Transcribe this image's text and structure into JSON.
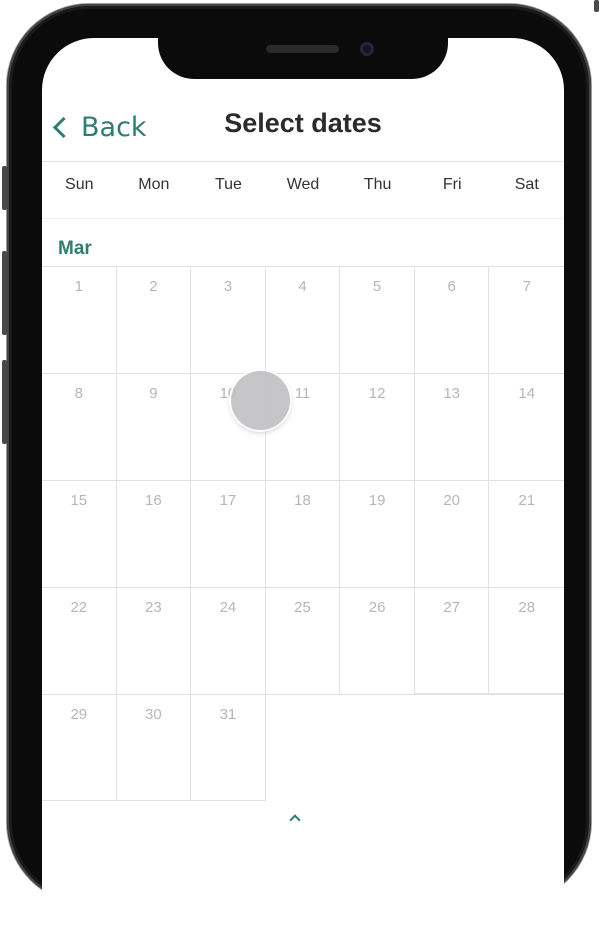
{
  "header": {
    "back_label": "Back",
    "title": "Select dates"
  },
  "weekdays": [
    "Sun",
    "Mon",
    "Tue",
    "Wed",
    "Thu",
    "Fri",
    "Sat"
  ],
  "calendar": {
    "month": "Mar",
    "weeks": [
      [
        "1",
        "2",
        "3",
        "4",
        "5",
        "6",
        "7"
      ],
      [
        "8",
        "9",
        "10",
        "11",
        "12",
        "13",
        "14"
      ],
      [
        "15",
        "16",
        "17",
        "18",
        "19",
        "20",
        "21"
      ],
      [
        "22",
        "23",
        "24",
        "25",
        "26",
        "27",
        "28"
      ],
      [
        "29",
        "30",
        "31"
      ]
    ]
  },
  "colors": {
    "accent": "#2e7d71",
    "title": "#2b2b2b",
    "day_number": "#b6b6b6",
    "grid_line": "#e2e2e2"
  },
  "icons": {
    "back": "chevron-left-icon",
    "touch": "touch-indicator"
  }
}
